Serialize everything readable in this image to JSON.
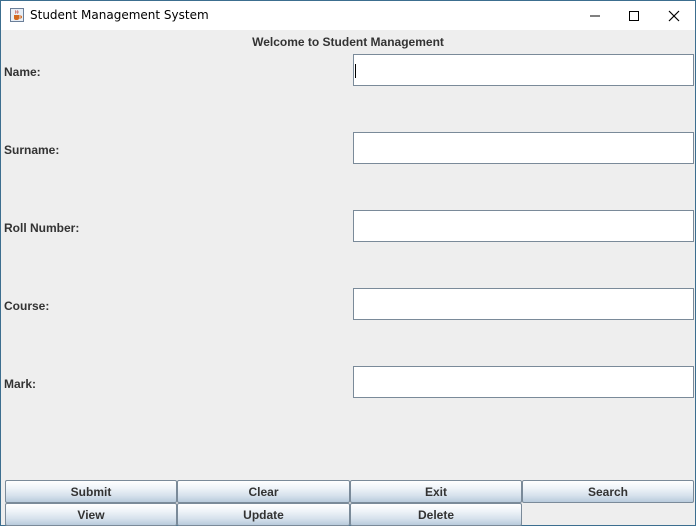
{
  "window": {
    "title": "Student Management System"
  },
  "header": {
    "text": "Welcome to Student Management"
  },
  "fields": [
    {
      "label": "Name:",
      "value": ""
    },
    {
      "label": "Surname:",
      "value": ""
    },
    {
      "label": "Roll Number:",
      "value": ""
    },
    {
      "label": "Course:",
      "value": ""
    },
    {
      "label": "Mark:",
      "value": ""
    }
  ],
  "buttons": {
    "submit": "Submit",
    "clear": "Clear",
    "exit": "Exit",
    "search": "Search",
    "view": "View",
    "update": "Update",
    "delete": "Delete"
  },
  "icons": {
    "app": "java-cup-icon",
    "minimize": "minimize-icon",
    "maximize": "maximize-icon",
    "close": "close-icon"
  }
}
